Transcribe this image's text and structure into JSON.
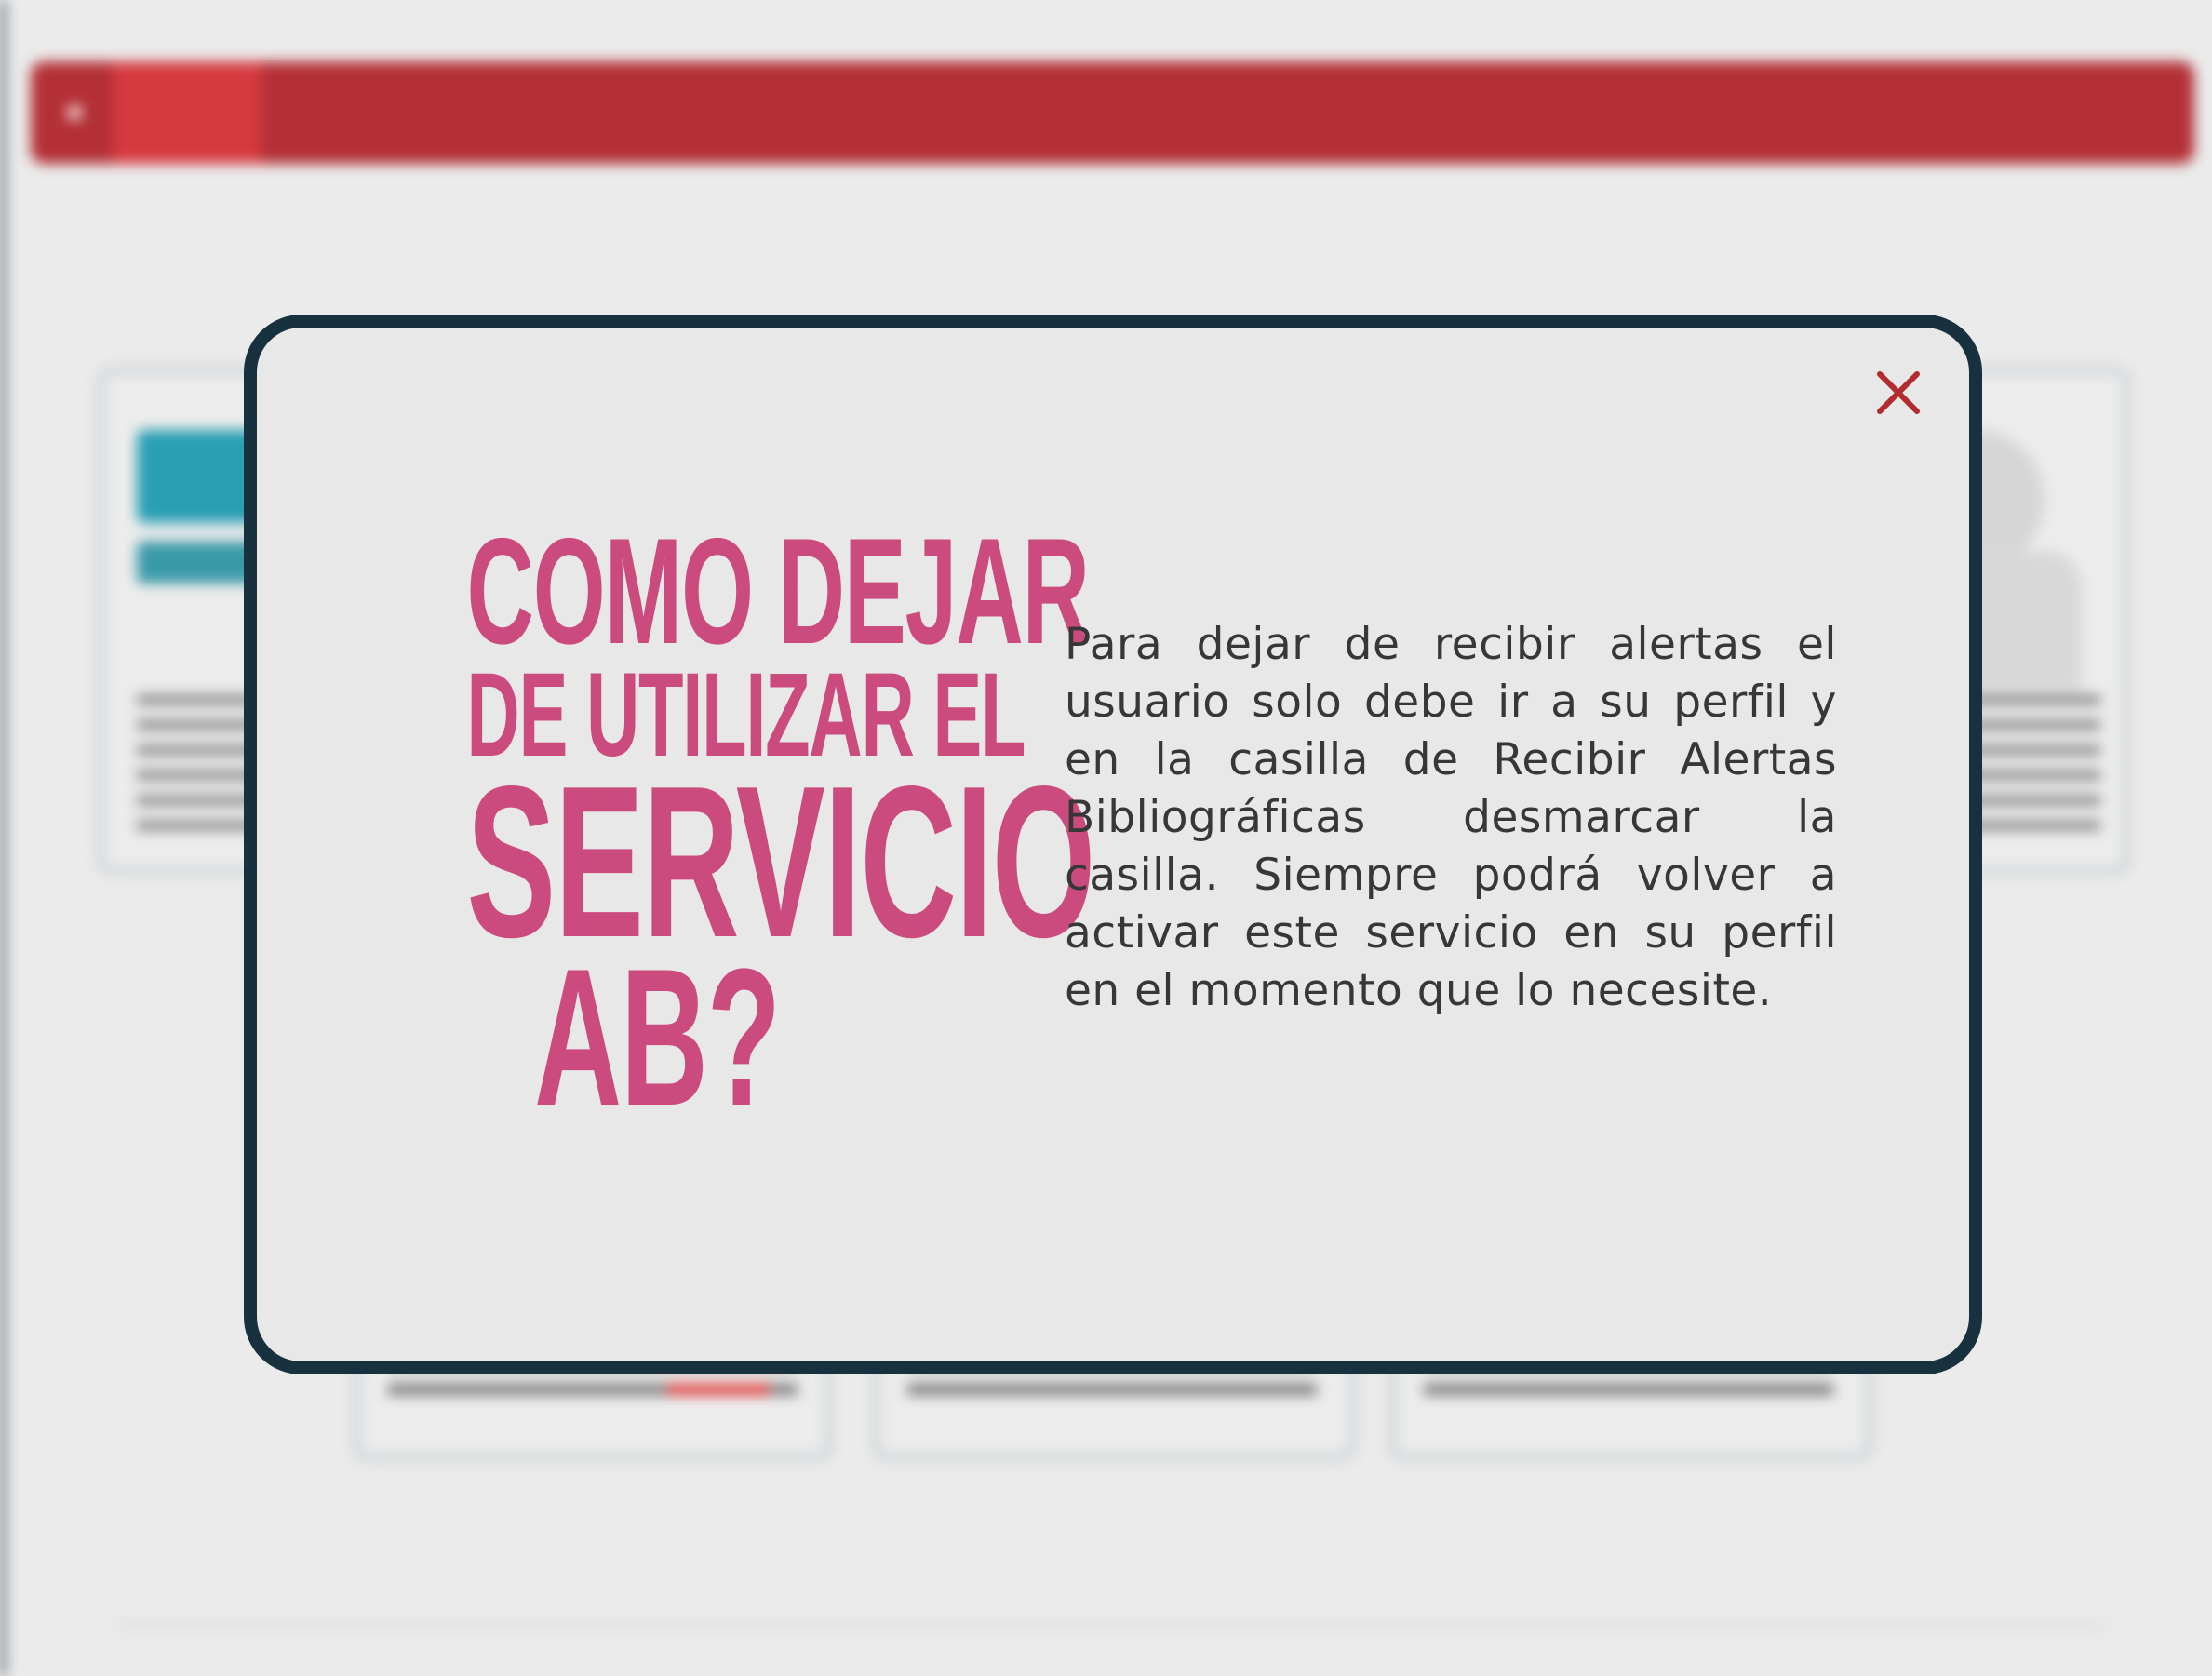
{
  "colors": {
    "navbar": "#b33036",
    "nav_active": "#d53a3f",
    "page_title": "#f0a246",
    "modal_border": "#17313f",
    "modal_bg": "#e8e8e8",
    "heading": "#cb4b7e",
    "close_icon": "#b32a2f",
    "body_text": "#373737"
  },
  "icons": {
    "nav_home": "menu-icon",
    "close": "close-icon"
  },
  "modal": {
    "heading": {
      "line1": "COMO DEJAR",
      "line2": "DE UTILIZAR EL",
      "line3": "SERVICIO",
      "line4": "AB?"
    },
    "body": "Para dejar de recibir alertas el usuario solo debe ir a su perfil y en la casilla de Recibir Alertas Bibliográficas desmarcar la casilla. Siempre podrá volver a activar este servicio en su perfil en el momento que lo necesite."
  }
}
